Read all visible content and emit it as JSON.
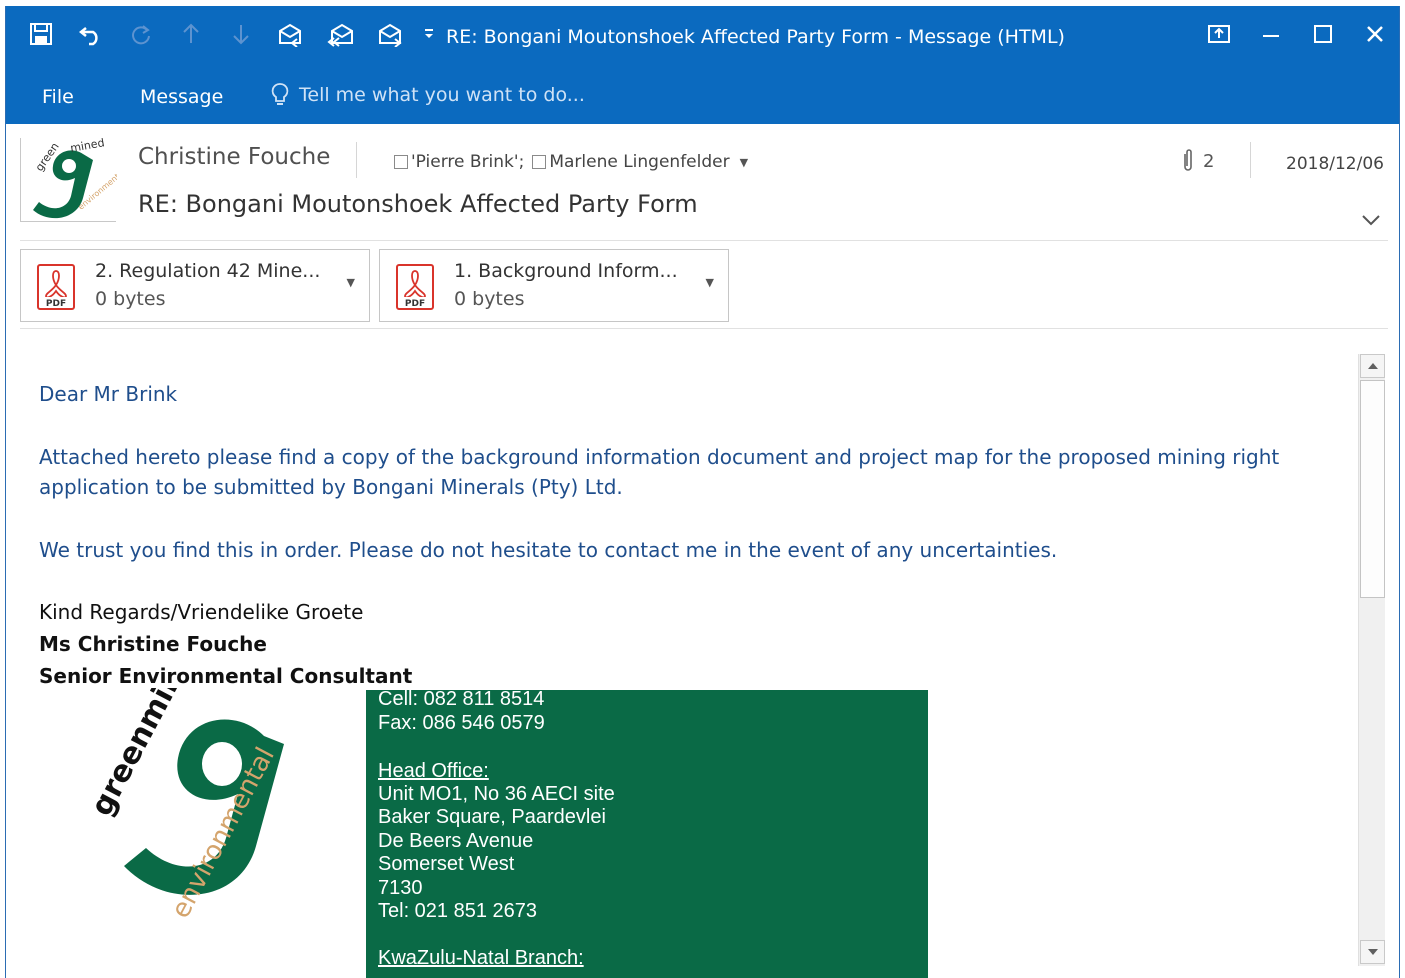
{
  "window": {
    "title": "RE: Bongani Moutonshoek Affected Party Form - Message (HTML)",
    "accent": "#0b6abf"
  },
  "quick_access": [
    "save-icon",
    "undo-icon",
    "redo-icon",
    "up-arrow-icon",
    "down-arrow-icon",
    "reply-icon",
    "reply-all-icon",
    "forward-icon",
    "customize-icon"
  ],
  "ribbon": {
    "tabs": [
      "File",
      "Message"
    ],
    "tell_me": "Tell me what you want to do..."
  },
  "header": {
    "sender": "Christine Fouche",
    "recipients": [
      "'Pierre Brink';",
      "Marlene Lingenfelder"
    ],
    "attachment_count": "2",
    "date": "2018/12/06",
    "subject": "RE: Bongani Moutonshoek Affected Party Form"
  },
  "attachments": [
    {
      "name": "2. Regulation 42 Mine...",
      "size": "0 bytes",
      "icon": "pdf-icon",
      "type_label": "PDF"
    },
    {
      "name": "1. Background Inform...",
      "size": "0 bytes",
      "icon": "pdf-icon",
      "type_label": "PDF"
    }
  ],
  "body": {
    "greeting": "Dear Mr Brink",
    "para1_line1": "Attached hereto please find a copy of the background information document and project map for the proposed mining right",
    "para1_line2": "application to be submitted by Bongani Minerals (Pty) Ltd.",
    "para2": "We trust you find this in order.  Please do not hesitate to contact me in the event of any uncertainties.",
    "closing": "Kind Regards/Vriendelike Groete",
    "sig_name": "Ms Christine Fouche",
    "sig_title": "Senior Environmental Consultant",
    "logo_text_top": "greenmined",
    "logo_text_bottom": "environmental",
    "contact": {
      "cell": "Cell: 082 811 8514",
      "fax": "Fax: 086 546 0579",
      "head_office_label": "Head Office:",
      "address": [
        "Unit MO1, No 36 AECI site",
        "Baker Square, Paardevlei",
        "De Beers Avenue",
        "Somerset West",
        "7130"
      ],
      "tel": "Tel: 021 851 2673",
      "branch_label": "KwaZulu-Natal Branch:"
    },
    "text_color": "#1f4e8c",
    "box_color": "#0a6a46"
  }
}
